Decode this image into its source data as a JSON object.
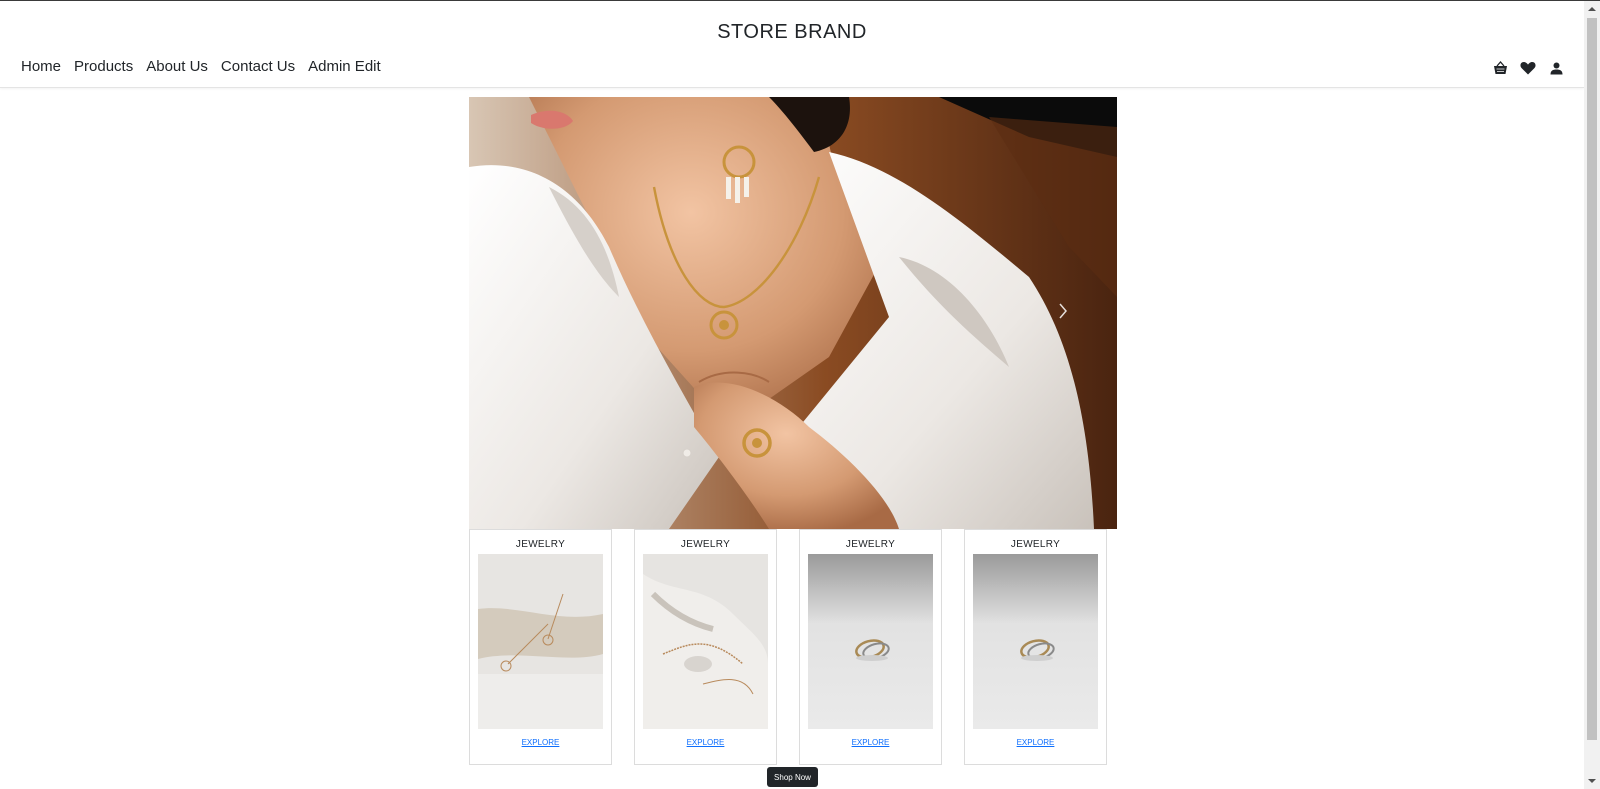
{
  "header": {
    "brand": "STORE BRAND",
    "nav": [
      "Home",
      "Products",
      "About Us",
      "Contact Us",
      "Admin Edit"
    ],
    "icons": [
      "basket-icon",
      "heart-icon",
      "user-icon"
    ]
  },
  "hero": {
    "image": "woman-jewelry-photo",
    "next_icon": "chevron-right-icon"
  },
  "cards": [
    {
      "title": "JEWELRY",
      "link": "EXPLORE",
      "image": "earrings-photo"
    },
    {
      "title": "JEWELRY",
      "link": "EXPLORE",
      "image": "necklace-photo"
    },
    {
      "title": "JEWELRY",
      "link": "EXPLORE",
      "image": "rings-photo"
    },
    {
      "title": "JEWELRY",
      "link": "EXPLORE",
      "image": "rings-photo"
    }
  ],
  "shop_now": "Shop Now",
  "colors": {
    "link": "#0d6efd",
    "dark": "#212529"
  }
}
